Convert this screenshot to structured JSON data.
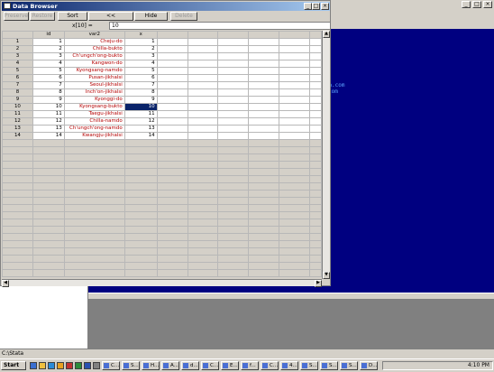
{
  "window": {
    "title": "Data Browser",
    "controls": [
      "_",
      "□",
      "×"
    ]
  },
  "toolbar": {
    "buttons": [
      {
        "label": "Preserve",
        "enabled": false
      },
      {
        "label": "Restore",
        "enabled": false
      },
      {
        "label": "Sort",
        "enabled": true
      },
      {
        "label": "<<",
        "enabled": true
      },
      {
        "label": "Hide",
        "enabled": true
      },
      {
        "label": "Delete",
        "enabled": false
      }
    ]
  },
  "varline": {
    "label": "x[10] =",
    "value": "10"
  },
  "table": {
    "columns": [
      "id",
      "var2",
      "x"
    ],
    "rows": [
      {
        "n": "1",
        "id": "1",
        "var2": "Cheju-do",
        "x": "1"
      },
      {
        "n": "2",
        "id": "2",
        "var2": "Chilla-bukto",
        "x": "2"
      },
      {
        "n": "3",
        "id": "3",
        "var2": "Ch'ungch'ong-bukto",
        "x": "3"
      },
      {
        "n": "4",
        "id": "4",
        "var2": "Kangwon-do",
        "x": "4"
      },
      {
        "n": "5",
        "id": "5",
        "var2": "Kyongsang-namdo",
        "x": "5"
      },
      {
        "n": "6",
        "id": "6",
        "var2": "Pusan-jikhalsi",
        "x": "6"
      },
      {
        "n": "7",
        "id": "7",
        "var2": "Seoul-jikhalsi",
        "x": "7"
      },
      {
        "n": "8",
        "id": "8",
        "var2": "Inch'on-jikhalsi",
        "x": "8"
      },
      {
        "n": "9",
        "id": "9",
        "var2": "Kyonggi-do",
        "x": "9"
      },
      {
        "n": "10",
        "id": "10",
        "var2": "Kyongsang-bukto",
        "x": "10"
      },
      {
        "n": "11",
        "id": "11",
        "var2": "Taegu-jikhalsi",
        "x": "11"
      },
      {
        "n": "12",
        "id": "12",
        "var2": "Chilla-namdo",
        "x": "12"
      },
      {
        "n": "13",
        "id": "13",
        "var2": "Ch'ungch'ong-namdo",
        "x": "13"
      },
      {
        "n": "14",
        "id": "14",
        "var2": "Kwangju-jikhalsi",
        "x": "14"
      }
    ],
    "selected": {
      "row": "10",
      "column": "x"
    }
  },
  "background": {
    "text_lines": [
      "stata.com",
      "com"
    ]
  },
  "statusbar": {
    "path": "C:\\Stata"
  },
  "taskbar": {
    "start_label": "Start",
    "tasks": [
      "C...",
      "S...",
      "H...",
      "A...",
      "d...",
      "C...",
      "E...",
      "f...",
      "C...",
      "4...",
      "S...",
      "S...",
      "S...",
      "D..."
    ],
    "clock": "4:10 PM"
  },
  "colors": {
    "title_start": "#0a246a",
    "title_end": "#a6caf0",
    "string_text": "#b40000",
    "selection": "#0a246a",
    "results_bg": "#000080"
  }
}
